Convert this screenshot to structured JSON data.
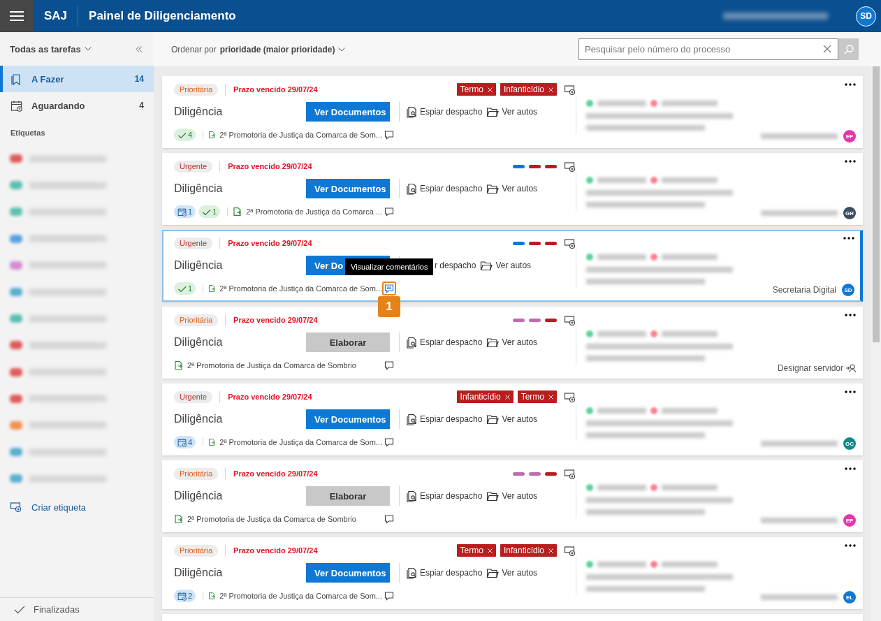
{
  "header": {
    "app": "SAJ",
    "title": "Painel de Diligenciamento",
    "user": {
      "initials": "SD"
    }
  },
  "sidebar": {
    "filter": "Todas as tarefas",
    "items": [
      {
        "label": "A Fazer",
        "count": "14",
        "kind": "todo",
        "selected": true
      },
      {
        "label": "Aguardando",
        "count": "4",
        "kind": "waiting",
        "selected": false
      }
    ],
    "labels_heading": "Etiquetas",
    "labels": [
      {
        "color": "#e05a5a"
      },
      {
        "color": "#5bbfb0"
      },
      {
        "color": "#5bbfb0"
      },
      {
        "color": "#5aa0e0"
      },
      {
        "color": "#d58ad0"
      },
      {
        "color": "#5aaed0"
      },
      {
        "color": "#5bbfb0"
      },
      {
        "color": "#e05a5a"
      },
      {
        "color": "#e05a5a"
      },
      {
        "color": "#e05a5a"
      },
      {
        "color": "#f09050"
      },
      {
        "color": "#5aaed0"
      },
      {
        "color": "#5aaed0"
      }
    ],
    "create_label": "Criar etiqueta",
    "finished": "Finalizadas"
  },
  "toolbar": {
    "sort_prefix": "Ordenar por",
    "sort_value": "prioridade (maior prioridade)",
    "search": {
      "placeholder": "Pesquisar pelo número do processo"
    }
  },
  "cards": [
    {
      "priority": {
        "label": "Prioritária",
        "kind": "high"
      },
      "deadline": "Prazo vencido 29/07/24",
      "selected": false,
      "tags": [
        {
          "kind": "chip",
          "label": "Termo",
          "color": "#b91d1d"
        },
        {
          "kind": "chip",
          "label": "Infanticídio",
          "color": "#b91d1d"
        }
      ],
      "title": "Diligência",
      "action": {
        "label": "Ver Documentos",
        "kind": "primary"
      },
      "peek": "Espiar despacho",
      "files": "Ver autos",
      "badges": [
        {
          "kind": "done",
          "count": "4"
        }
      ],
      "office": "2ª Promotoria de Justiça da Comarca de Som...",
      "comment": {
        "highlighted": false
      },
      "assignee": {
        "kind": "avatar",
        "initials": "EP",
        "color": "#e535ab"
      }
    },
    {
      "priority": {
        "label": "Urgente",
        "kind": "urgent"
      },
      "deadline": "Prazo vencido 29/07/24",
      "selected": false,
      "tags": [
        {
          "kind": "bar",
          "color": "#0f78d4"
        },
        {
          "kind": "bar",
          "color": "#b91d1d"
        },
        {
          "kind": "bar",
          "color": "#b91d1d"
        }
      ],
      "title": "Diligência",
      "action": {
        "label": "Ver Documentos",
        "kind": "primary"
      },
      "peek": "Espiar despacho",
      "files": "Ver autos",
      "badges": [
        {
          "kind": "scheduled",
          "count": "1"
        },
        {
          "kind": "done",
          "count": "1"
        }
      ],
      "office": "2ª Promotoria de Justiça da Comarca ...",
      "comment": {
        "highlighted": false
      },
      "assignee": {
        "kind": "avatar",
        "initials": "GR",
        "color": "#3a4e63"
      }
    },
    {
      "priority": {
        "label": "Urgente",
        "kind": "urgent"
      },
      "deadline": "Prazo vencido 29/07/24",
      "selected": true,
      "tags": [
        {
          "kind": "bar",
          "color": "#0f78d4"
        },
        {
          "kind": "bar",
          "color": "#b91d1d"
        },
        {
          "kind": "bar",
          "color": "#b91d1d"
        }
      ],
      "title": "Diligência",
      "action": {
        "label": "Ver Do",
        "kind": "primary"
      },
      "peek": "r despacho",
      "peek_icon": false,
      "files": "Ver autos",
      "badges": [
        {
          "kind": "done",
          "count": "1"
        }
      ],
      "office": "2ª Promotoria de Justiça da Comarca de Som...",
      "comment": {
        "highlighted": true,
        "tooltip": "Visualizar comentários",
        "callout": "1"
      },
      "assignee": {
        "kind": "avatar",
        "initials": "SD",
        "color": "#0f78d4",
        "name": "Secretaria Digital"
      }
    },
    {
      "priority": {
        "label": "Prioritária",
        "kind": "high"
      },
      "deadline": "Prazo vencido 29/07/24",
      "selected": false,
      "tags": [
        {
          "kind": "bar",
          "color": "#c06cb4"
        },
        {
          "kind": "bar",
          "color": "#c06cb4"
        },
        {
          "kind": "bar",
          "color": "#b91d1d"
        }
      ],
      "title": "Diligência",
      "action": {
        "label": "Elaborar",
        "kind": "secondary"
      },
      "peek": "Espiar despacho",
      "files": "Ver autos",
      "office": "2ª Promotoria de Justiça da Comarca de Sombrio",
      "comment": {
        "highlighted": false
      },
      "assignee": {
        "kind": "assign",
        "label": "Designar servidor"
      }
    },
    {
      "priority": {
        "label": "Urgente",
        "kind": "urgent"
      },
      "deadline": "Prazo vencido 29/07/24",
      "selected": false,
      "tags": [
        {
          "kind": "chip",
          "label": "Infanticídio",
          "color": "#b91d1d"
        },
        {
          "kind": "chip",
          "label": "Termo",
          "color": "#b91d1d"
        }
      ],
      "title": "Diligência",
      "action": {
        "label": "Ver Documentos",
        "kind": "primary"
      },
      "peek": "Espiar despacho",
      "files": "Ver autos",
      "badges": [
        {
          "kind": "scheduled",
          "count": "4"
        }
      ],
      "office": "2ª Promotoria de Justiça da Comarca de Som...",
      "comment": {
        "highlighted": false
      },
      "assignee": {
        "kind": "avatar",
        "initials": "GC",
        "color": "#0e8a8a"
      }
    },
    {
      "priority": {
        "label": "Prioritária",
        "kind": "high"
      },
      "deadline": "Prazo vencido 29/07/24",
      "selected": false,
      "tags": [
        {
          "kind": "bar",
          "color": "#c06cb4"
        },
        {
          "kind": "bar",
          "color": "#c06cb4"
        },
        {
          "kind": "bar",
          "color": "#b91d1d"
        }
      ],
      "title": "Diligência",
      "action": {
        "label": "Elaborar",
        "kind": "secondary"
      },
      "peek": "Espiar despacho",
      "files": "Ver autos",
      "office": "2ª Promotoria de Justiça da Comarca de Sombrio",
      "comment": {
        "highlighted": false
      },
      "assignee": {
        "kind": "avatar",
        "initials": "EP",
        "color": "#e535ab"
      }
    },
    {
      "priority": {
        "label": "Prioritária",
        "kind": "high"
      },
      "deadline": "Prazo vencido 29/07/24",
      "selected": false,
      "tags": [
        {
          "kind": "chip",
          "label": "Termo",
          "color": "#b91d1d"
        },
        {
          "kind": "chip",
          "label": "Infanticídio",
          "color": "#b91d1d"
        }
      ],
      "title": "Diligência",
      "action": {
        "label": "Ver Documentos",
        "kind": "primary"
      },
      "peek": "Espiar despacho",
      "files": "Ver autos",
      "badges": [
        {
          "kind": "scheduled",
          "count": "2"
        }
      ],
      "office": "2ª Promotoria de Justiça da Comarca de Som...",
      "comment": {
        "highlighted": false
      },
      "assignee": {
        "kind": "avatar",
        "initials": "EL",
        "color": "#0f78d4"
      }
    }
  ]
}
